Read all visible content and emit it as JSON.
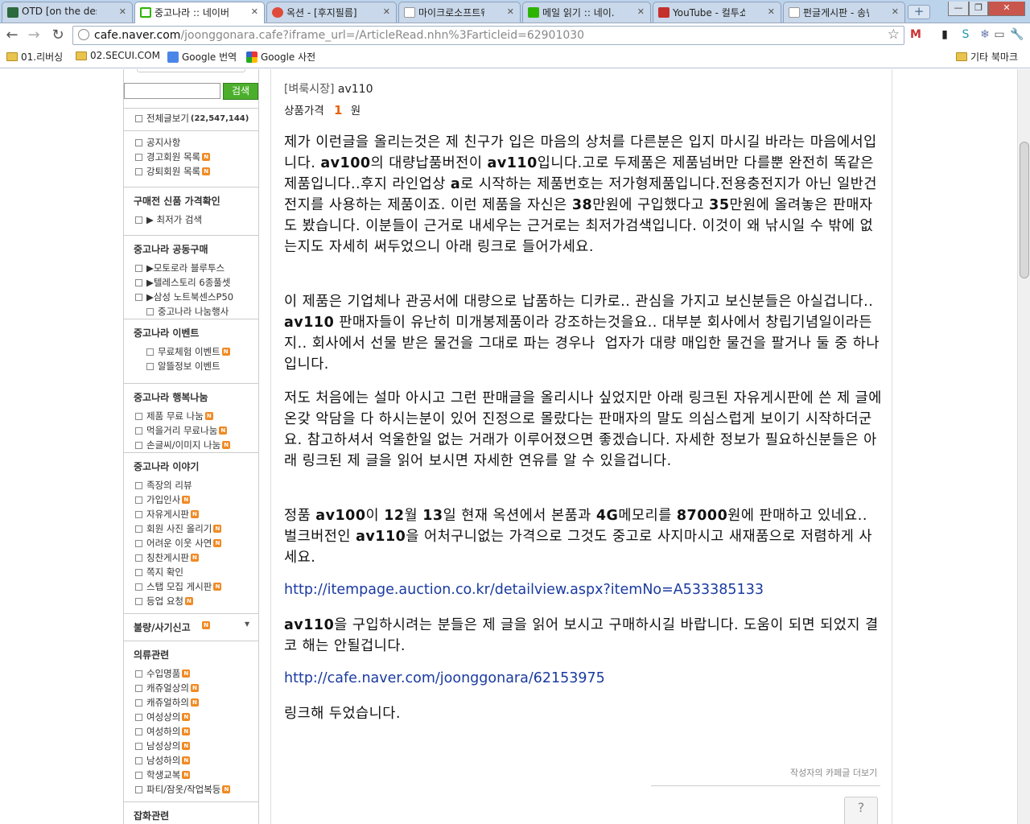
{
  "tabs": [
    {
      "title": "OTD [on the desk]",
      "icon": "grid-app-icon"
    },
    {
      "title": "중고나라 :: 네이버...",
      "icon": "naver-cafe-icon"
    },
    {
      "title": "옥션 - [후지필름] ...",
      "icon": "auction-icon"
    },
    {
      "title": "마이크로소프트웨어",
      "icon": "page-icon"
    },
    {
      "title": "메일 읽기 :: 네이...",
      "icon": "mail-icon"
    },
    {
      "title": "YouTube - 컬투쇼...",
      "icon": "youtube-icon"
    },
    {
      "title": "펀글게시판 - 송년...",
      "icon": "page-icon"
    }
  ],
  "address": {
    "domain": "cafe.naver.com",
    "path": "/joonggonara.cafe?iframe_url=/ArticleRead.nhn%3Farticleid=62901030"
  },
  "bookmarks": [
    {
      "label": "01.리버싱",
      "icon": "folder-icon"
    },
    {
      "label": "02.SECUI.COM",
      "icon": "folder-icon"
    },
    {
      "label": "Google 번역",
      "icon": "translate-icon"
    },
    {
      "label": "Google 사전",
      "icon": "dictionary-icon"
    }
  ],
  "bookmarks_other": "기타 북마크",
  "sidebar": {
    "search_button": "검색",
    "all_posts": "전체글보기",
    "all_posts_count": "(22,547,144)",
    "sections": [
      {
        "title": "",
        "items": [
          "공지사항",
          "경고회원 목록",
          "강퇴회원 목록"
        ],
        "badges": [
          false,
          true,
          true
        ]
      },
      {
        "title": "구매전 신품 가격확인",
        "items": [
          "▶ 최저가 검색"
        ],
        "badges": [
          false
        ]
      },
      {
        "title": "중고나라 공동구매",
        "items": [
          "▶모토로라 블루투스",
          "▶텔레스토리 6종풀셋",
          "▶삼성 노트북센스P50",
          "중고나라 나눔행사"
        ],
        "badges": [
          false,
          false,
          false,
          false
        ]
      },
      {
        "title": "중고나라 이벤트",
        "items": [
          "무료체험 이벤트",
          "알뜰정보 이벤트"
        ],
        "badges": [
          true,
          false
        ]
      },
      {
        "title": "중고나라 행복나눔",
        "items": [
          "제품 무료 나눔",
          "먹을거리 무료나눔",
          "손글씨/이미지 나눔"
        ],
        "badges": [
          true,
          true,
          true
        ]
      },
      {
        "title": "중고나라 이야기",
        "items": [
          "족장의 리뷰",
          "가입인사",
          "자유게시판",
          "회원 사진 올리기",
          "어려운 이웃 사연",
          "칭찬게시판",
          "쪽지 확인",
          "스탭 모집 게시판",
          "등업 요청"
        ],
        "badges": [
          false,
          true,
          true,
          true,
          true,
          true,
          false,
          true,
          true
        ]
      },
      {
        "title": "불량/사기신고",
        "items": [],
        "badges": []
      },
      {
        "title": "의류관련",
        "items": [
          "수입명품",
          "캐쥬얼상의",
          "캐쥬얼하의",
          "여성상의",
          "여성하의",
          "남성상의",
          "남성하의",
          "학생교복",
          "파티/잠옷/작업복등"
        ],
        "badges": [
          true,
          true,
          true,
          true,
          true,
          true,
          true,
          true,
          true
        ]
      },
      {
        "title": "잡화관련",
        "items": [],
        "badges": []
      }
    ]
  },
  "article": {
    "category": "[벼룩시장]",
    "title": "av110",
    "price_label": "상품가격",
    "price_value": "1",
    "price_unit": "원",
    "paragraphs": [
      "제가 이런글을 올리는것은 제 친구가 입은 마음의 상처를 다른분은 입지 마시길 바라는 마음에서입니다. <b>av100</b>의 대량납품버전이 <b>av110</b>입니다.고로 두제품은 제품넘버만 다를뿐 완전히 똑같은 제품입니다..후지 라인업상 <b>a</b>로 시작하는 제품번호는 저가형제품입니다.전용충전지가 아닌 일반건전지를 사용하는 제품이죠. 이런 제품을 자신은 <b>38</b>만원에 구입했다고 <b>35</b>만원에 올려놓은 판매자도 봤습니다. 이분들이 근거로 내세우는 근거로는 최저가검색입니다. 이것이 왜 낚시일 수 밖에 없는지도 자세히 써두었으니 아래 링크로 들어가세요.",
      "이 제품은 기업체나 관공서에 대량으로 납품하는 디카로.. 관심을 가지고 보신분들은 아실겁니다.. <b>av110</b> 판매자들이 유난히 미개봉제품이라 강조하는것을요.. 대부분 회사에서 창립기념일이라든지.. 회사에서 선물 받은 물건을 그대로 파는 경우나&nbsp; 업자가 대량 매입한 물건을 팔거나 둘 중 하나입니다.",
      "저도 처음에는 설마 아시고 그런 판매글을 올리시나 싶었지만 아래 링크된 자유게시판에 쓴 제 글에 온갖 악담을 다 하시는분이 있어 진정으로 몰랐다는 판매자의 말도 의심스럽게 보이기 시작하더군요. 참고하셔서 억울한일 없는 거래가 이루어졌으면 좋겠습니다. 자세한 정보가 필요하신분들은 아래 링크된 제 글을 읽어 보시면 자세한 연유를 알 수 있을겁니다.",
      "정품 <b>av100</b>이 <b>12</b>월 <b>13</b>일 현재 옥션에서 본품과 <b>4G</b>메모리를 <b>87000</b>원에 판매하고 있네요.. 벌크버전인 <b>av110</b>을 어처구니없는 가격으로 그것도 중고로 사지마시고 새재품으로 저렴하게 사세요."
    ],
    "link1": "http://itempage.auction.co.kr/detailview.aspx?itemNo=A533385133",
    "paragraph5": "<b>av110</b>을 구입하시려는 분들은 제 글을 읽어 보시고 구매하시길 바랍니다. 도움이 되면 되었지 결코 해는 안될겁니다.",
    "link2": "http://cafe.naver.com/joonggonara/62153975",
    "closing": "링크해 두었습니다.",
    "more_posts": "작성자의 카페글 더보기"
  }
}
